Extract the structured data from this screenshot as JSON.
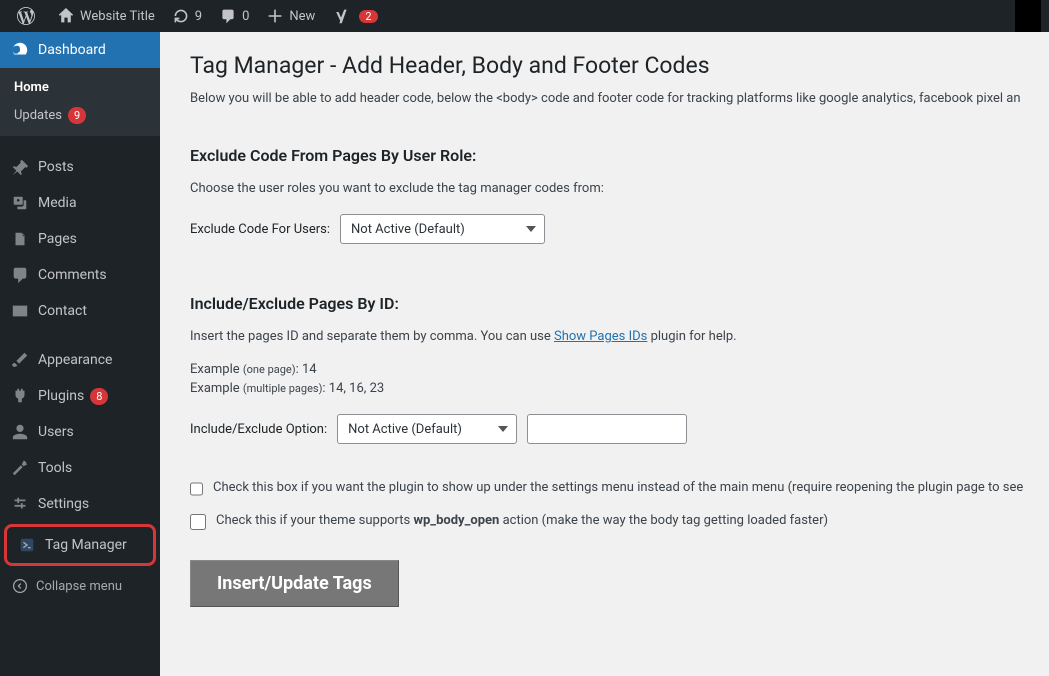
{
  "adminbar": {
    "site_title": "Website Title",
    "updates_count": "9",
    "comments_count": "0",
    "new_label": "New",
    "yoast_count": "2"
  },
  "sidebar": {
    "dashboard": "Dashboard",
    "home": "Home",
    "updates": "Updates",
    "updates_count": "9",
    "posts": "Posts",
    "media": "Media",
    "pages": "Pages",
    "comments": "Comments",
    "contact": "Contact",
    "appearance": "Appearance",
    "plugins": "Plugins",
    "plugins_count": "8",
    "users": "Users",
    "tools": "Tools",
    "settings": "Settings",
    "tag_manager": "Tag Manager",
    "collapse": "Collapse menu"
  },
  "main": {
    "title": "Tag Manager - Add Header, Body and Footer Codes",
    "description": "Below you will be able to add header code, below the <body> code and footer code for tracking platforms like google analytics, facebook pixel an",
    "exclude_role": {
      "heading": "Exclude Code From Pages By User Role:",
      "desc": "Choose the user roles you want to exclude the tag manager codes from:",
      "label": "Exclude Code For Users:",
      "selected": "Not Active (Default)"
    },
    "include_exclude": {
      "heading": "Include/Exclude Pages By ID:",
      "desc_pre": "Insert the pages ID and separate them by comma. You can use ",
      "desc_link": "Show Pages IDs",
      "desc_post": " plugin for help.",
      "example1_pre": "Example ",
      "example1_small": "(one page)",
      "example1_post": ": 14",
      "example2_pre": "Example ",
      "example2_small": "(multiple pages)",
      "example2_post": ": 14, 16, 23",
      "label": "Include/Exclude Option:",
      "selected": "Not Active (Default)"
    },
    "checkbox1": "Check this box if you want the plugin to show up under the settings menu instead of the main menu (require reopening the plugin page to see",
    "checkbox2_pre": "Check this if your theme supports ",
    "checkbox2_strong": "wp_body_open",
    "checkbox2_post": " action (make the way the body tag getting loaded faster)",
    "submit": "Insert/Update Tags"
  }
}
